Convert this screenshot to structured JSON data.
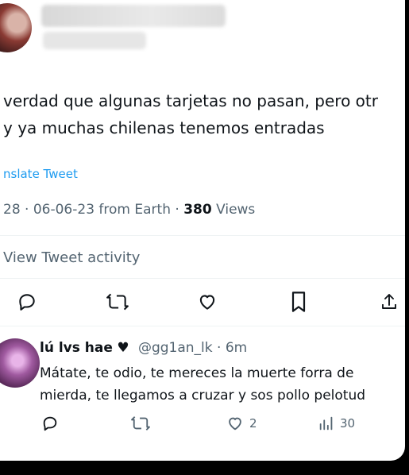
{
  "tweet": {
    "text_lines": [
      "verdad que algunas tarjetas no pasan, pero otr",
      "y ya muchas chilenas tenemos entradas"
    ],
    "translate_label": "nslate Tweet",
    "time_date": "28 · 06-06-23 from Earth · ",
    "views_count": "380",
    "views_label": " Views",
    "activity_label": "View Tweet activity"
  },
  "reply": {
    "name": "lú lvs hae",
    "heart": "♥",
    "handle": "@gg1an_lk · 6m",
    "text_lines": [
      "Mátate, te odio, te mereces la muerte forra de",
      "mierda, te llegamos a cruzar y sos pollo pelotud"
    ],
    "likes": "2",
    "views": "30"
  },
  "icons": {
    "reply": "reply-icon",
    "retweet": "retweet-icon",
    "like": "heart-icon",
    "bookmark": "bookmark-icon",
    "share": "share-icon",
    "views": "views-icon"
  },
  "colors": {
    "text": "#0f1419",
    "muted": "#536471",
    "link": "#1d9bf0",
    "divider": "#eff3f4"
  }
}
